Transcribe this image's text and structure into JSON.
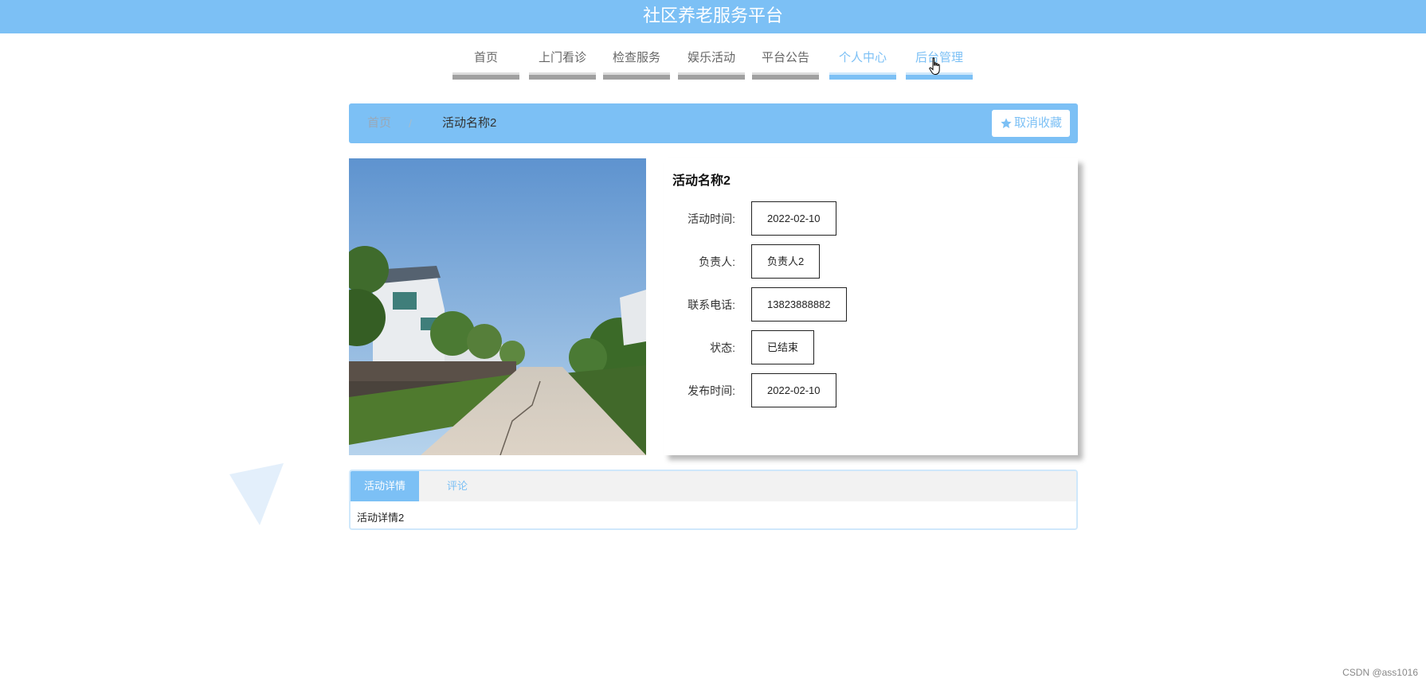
{
  "header": {
    "site_title": "社区养老服务平台"
  },
  "nav": {
    "items": [
      {
        "label": "首页"
      },
      {
        "label": "上门看诊"
      },
      {
        "label": "检查服务"
      },
      {
        "label": "娱乐活动"
      },
      {
        "label": "平台公告"
      },
      {
        "label": "个人中心"
      },
      {
        "label": "后台管理"
      }
    ],
    "active_items": [
      "个人中心",
      "后台管理"
    ],
    "accent_color": "#7cc0f5"
  },
  "breadcrumb": {
    "home": "首页",
    "separator": "/",
    "current": "活动名称2"
  },
  "favorite_button": {
    "label": "取消收藏",
    "icon": "star-icon"
  },
  "activity": {
    "image": {
      "description_icon": "photo-icon"
    },
    "title": "活动名称2",
    "fields": [
      {
        "key": "活动时间:",
        "value": "2022-02-10"
      },
      {
        "key": "负责人:",
        "value": "负责人2"
      },
      {
        "key": "联系电话:",
        "value": "13823888882"
      },
      {
        "key": "状态:",
        "value": "已结束"
      },
      {
        "key": "发布时间:",
        "value": "2022-02-10"
      }
    ]
  },
  "tabs": {
    "items": [
      {
        "label": "活动详情",
        "active": true
      },
      {
        "label": "评论",
        "active": false
      }
    ],
    "content": "活动详情2"
  },
  "footer": {
    "credit": "CSDN @ass1016"
  }
}
